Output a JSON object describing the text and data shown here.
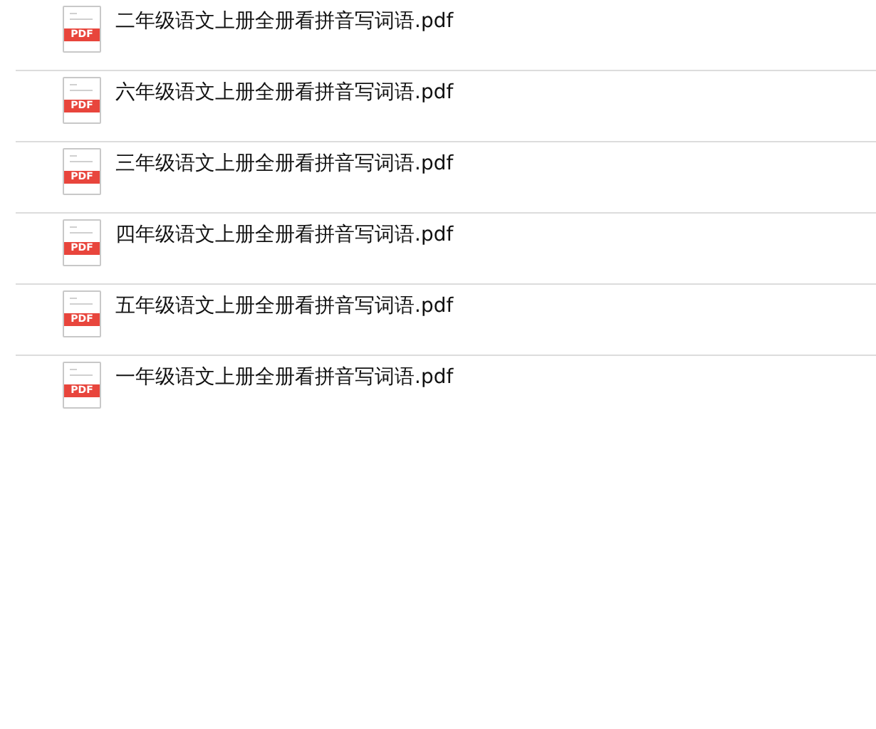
{
  "files": [
    {
      "name": "二年级语文上册全册看拼音写词语.pdf",
      "icon_label": "PDF"
    },
    {
      "name": "六年级语文上册全册看拼音写词语.pdf",
      "icon_label": "PDF"
    },
    {
      "name": "三年级语文上册全册看拼音写词语.pdf",
      "icon_label": "PDF"
    },
    {
      "name": "四年级语文上册全册看拼音写词语.pdf",
      "icon_label": "PDF"
    },
    {
      "name": "五年级语文上册全册看拼音写词语.pdf",
      "icon_label": "PDF"
    },
    {
      "name": "一年级语文上册全册看拼音写词语.pdf",
      "icon_label": "PDF"
    }
  ]
}
